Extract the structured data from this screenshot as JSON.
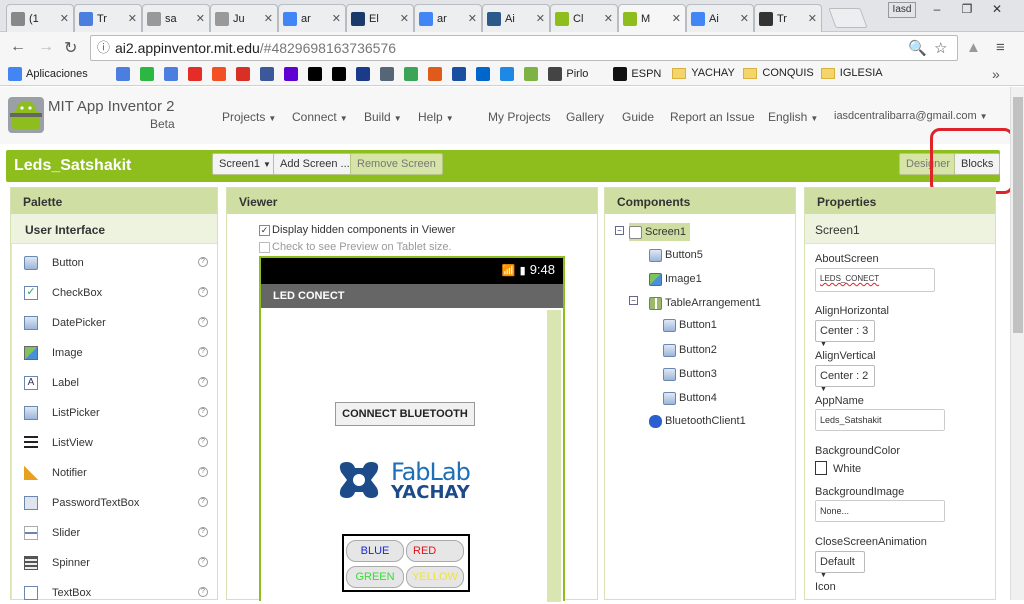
{
  "browser": {
    "tabs": [
      {
        "label": "(1",
        "icon": "generic-icon",
        "color": "#888888",
        "active": false
      },
      {
        "label": "Tr",
        "icon": "translate-icon",
        "color": "#4a7fe0",
        "active": false
      },
      {
        "label": "sa",
        "icon": "page-icon",
        "color": "#999999",
        "active": false
      },
      {
        "label": "Ju",
        "icon": "page-icon",
        "color": "#999999",
        "active": false
      },
      {
        "label": "ar",
        "icon": "google-icon",
        "color": "#4285f4",
        "active": false
      },
      {
        "label": "El",
        "icon": "site-icon",
        "color": "#1a3a6b",
        "active": false
      },
      {
        "label": "ar",
        "icon": "google-icon",
        "color": "#4285f4",
        "active": false
      },
      {
        "label": "Ai",
        "icon": "m-icon",
        "color": "#2b5a8a",
        "active": false
      },
      {
        "label": "Cl",
        "icon": "appinventor-icon",
        "color": "#8dbe1e",
        "active": false
      },
      {
        "label": "M",
        "icon": "appinventor-icon",
        "color": "#8dbe1e",
        "active": true
      },
      {
        "label": "Ai",
        "icon": "google-icon",
        "color": "#4285f4",
        "active": false
      },
      {
        "label": "Tr",
        "icon": "site-icon",
        "color": "#333333",
        "active": false
      }
    ],
    "window_user": "Iasd",
    "url_host": "ai2.appinventor.mit.edu",
    "url_path": "/#4829698163736576",
    "bookmarks": [
      {
        "label": "Aplicaciones",
        "icon": "apps-icon",
        "color": "#4285f4"
      },
      {
        "label": "",
        "icon": "translate-icon",
        "color": "#4a7fe0"
      },
      {
        "label": "",
        "icon": "whatsapp-icon",
        "color": "#2bb741"
      },
      {
        "label": "",
        "icon": "translate-icon",
        "color": "#4a7fe0"
      },
      {
        "label": "",
        "icon": "youtube-icon",
        "color": "#e52d27"
      },
      {
        "label": "",
        "icon": "windows-icon",
        "color": "#f25022"
      },
      {
        "label": "",
        "icon": "gmail-icon",
        "color": "#d93025"
      },
      {
        "label": "",
        "icon": "facebook-icon",
        "color": "#3b5998"
      },
      {
        "label": "",
        "icon": "yahoo-icon",
        "color": "#5f01d1"
      },
      {
        "label": "",
        "icon": "nyt-icon",
        "color": "#000000"
      },
      {
        "label": "",
        "icon": "bbc-icon",
        "color": "#000000"
      },
      {
        "label": "",
        "icon": "20-icon",
        "color": "#1a3a8a"
      },
      {
        "label": "",
        "icon": "globe-icon",
        "color": "#556677"
      },
      {
        "label": "",
        "icon": "tv-icon",
        "color": "#3aa655"
      },
      {
        "label": "",
        "icon": "et-icon",
        "color": "#e05a1a"
      },
      {
        "label": "",
        "icon": "eu-icon",
        "color": "#1a4fa0"
      },
      {
        "label": "",
        "icon": "ec-icon",
        "color": "#0066cc"
      },
      {
        "label": "",
        "icon": "play-icon",
        "color": "#1e88e5"
      },
      {
        "label": "",
        "icon": "m-circle-icon",
        "color": "#7cb342"
      },
      {
        "label": "Pirlo",
        "icon": "ptv-icon",
        "color": "#444444"
      },
      {
        "label": "ESPN",
        "icon": "tv-icon",
        "color": "#111111"
      },
      {
        "label": "YACHAY",
        "icon": "folder-icon",
        "color": "#f5d56b"
      },
      {
        "label": "CONQUIS",
        "icon": "folder-icon",
        "color": "#f5d56b"
      },
      {
        "label": "IGLESIA",
        "icon": "folder-icon",
        "color": "#f5d56b"
      }
    ]
  },
  "header": {
    "title": "MIT App Inventor 2",
    "subtitle": "Beta",
    "menus": [
      "Projects",
      "Connect",
      "Build",
      "Help"
    ],
    "links": [
      "My Projects",
      "Gallery",
      "Guide",
      "Report an Issue"
    ],
    "language": "English",
    "account": "iasdcentralibarra@gmail.com"
  },
  "project": {
    "name": "Leds_Satshakit",
    "screen_select": "Screen1",
    "add_screen": "Add Screen ...",
    "remove_screen": "Remove Screen",
    "designer": "Designer",
    "blocks": "Blocks",
    "accent": "#8dbe1e",
    "highlight_color": "#e0232a"
  },
  "palette": {
    "title": "Palette",
    "category": "User Interface",
    "items": [
      {
        "label": "Button",
        "icon": "button-icon"
      },
      {
        "label": "CheckBox",
        "icon": "checkbox-icon"
      },
      {
        "label": "DatePicker",
        "icon": "datepicker-icon"
      },
      {
        "label": "Image",
        "icon": "image-icon"
      },
      {
        "label": "Label",
        "icon": "label-icon"
      },
      {
        "label": "ListPicker",
        "icon": "listpicker-icon"
      },
      {
        "label": "ListView",
        "icon": "listview-icon"
      },
      {
        "label": "Notifier",
        "icon": "notifier-icon"
      },
      {
        "label": "PasswordTextBox",
        "icon": "password-icon"
      },
      {
        "label": "Slider",
        "icon": "slider-icon"
      },
      {
        "label": "Spinner",
        "icon": "spinner-icon"
      },
      {
        "label": "TextBox",
        "icon": "textbox-icon"
      }
    ],
    "help_glyph": "?"
  },
  "viewer": {
    "title": "Viewer",
    "hidden_label": "Display hidden components in Viewer",
    "hidden_checked": true,
    "tablet_label": "Check to see Preview on Tablet size.",
    "tablet_checked": false,
    "time": "9:48",
    "app_title": "LED CONECT",
    "connect_button": "CONNECT BLUETOOTH",
    "logo_fab": "FabLab",
    "logo_yachay": "YACHAY",
    "buttons": [
      {
        "label": "BLUE",
        "color": "#1a2ad0"
      },
      {
        "label": "RED",
        "color": "#e0141a"
      },
      {
        "label": "GREEN",
        "color": "#33dd33"
      },
      {
        "label": "YELLOW",
        "color": "#f0e430"
      }
    ]
  },
  "components": {
    "title": "Components",
    "tree": [
      {
        "label": "Screen1",
        "icon": "screen-icon",
        "level": 0
      },
      {
        "label": "Button5",
        "icon": "button-icon",
        "level": 1
      },
      {
        "label": "Image1",
        "icon": "image-icon",
        "level": 1
      },
      {
        "label": "TableArrangement1",
        "icon": "table-icon",
        "level": 1
      },
      {
        "label": "Button1",
        "icon": "button-icon",
        "level": 2
      },
      {
        "label": "Button2",
        "icon": "button-icon",
        "level": 2
      },
      {
        "label": "Button3",
        "icon": "button-icon",
        "level": 2
      },
      {
        "label": "Button4",
        "icon": "button-icon",
        "level": 2
      },
      {
        "label": "BluetoothClient1",
        "icon": "bluetooth-icon",
        "level": 1
      }
    ]
  },
  "properties": {
    "title": "Properties",
    "component": "Screen1",
    "fields": [
      {
        "label": "AboutScreen",
        "value": "LEDS_CONECT",
        "kind": "textarea"
      },
      {
        "label": "AlignHorizontal",
        "value": "Center : 3",
        "kind": "select"
      },
      {
        "label": "AlignVertical",
        "value": "Center : 2",
        "kind": "select"
      },
      {
        "label": "AppName",
        "value": "Leds_Satshakit",
        "kind": "input"
      },
      {
        "label": "BackgroundColor",
        "value": "White",
        "kind": "color"
      },
      {
        "label": "BackgroundImage",
        "value": "None...",
        "kind": "input"
      },
      {
        "label": "CloseScreenAnimation",
        "value": "Default",
        "kind": "select"
      },
      {
        "label": "Icon",
        "value": "",
        "kind": "label"
      }
    ]
  }
}
